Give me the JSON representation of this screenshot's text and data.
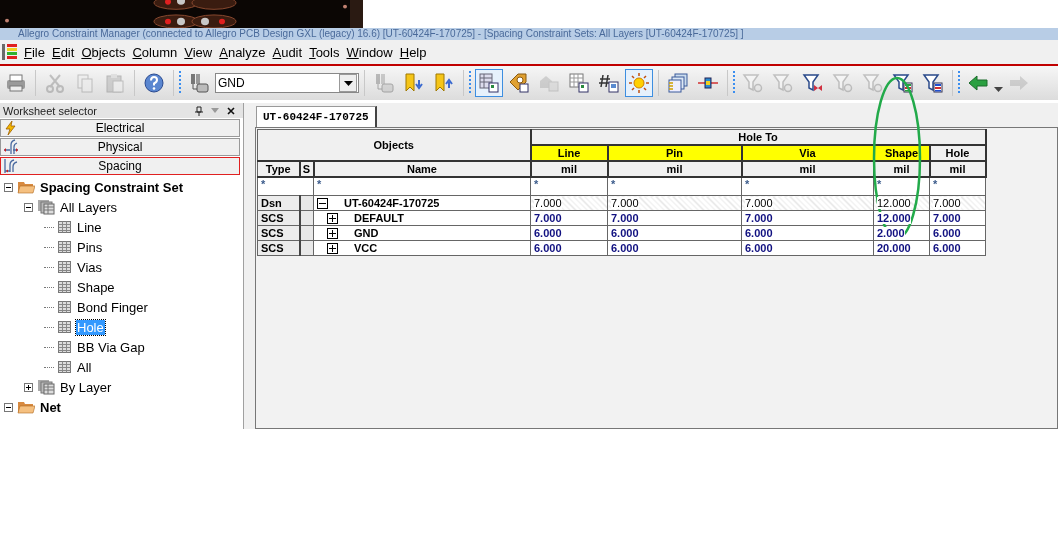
{
  "window": {
    "title": "Allegro Constraint Manager (connected to Allegro PCB Design GXL (legacy) 16.6) [UT-60424F-170725] - [Spacing Constraint Sets: All Layers [UT-60424F-170725] ]"
  },
  "menu": [
    "File",
    "Edit",
    "Objects",
    "Column",
    "View",
    "Analyze",
    "Audit",
    "Tools",
    "Window",
    "Help"
  ],
  "toolbar": [
    {
      "kind": "print",
      "disabled": false,
      "selected": false
    },
    {
      "kind": "separator"
    },
    {
      "kind": "cut",
      "disabled": true,
      "selected": false
    },
    {
      "kind": "copy",
      "disabled": true,
      "selected": false
    },
    {
      "kind": "paste",
      "disabled": true,
      "selected": false
    },
    {
      "kind": "separator"
    },
    {
      "kind": "help",
      "disabled": false,
      "selected": false
    },
    {
      "kind": "grip"
    },
    {
      "kind": "net",
      "disabled": false,
      "selected": false
    },
    {
      "kind": "combo",
      "value": "GND"
    },
    {
      "kind": "separator"
    },
    {
      "kind": "net",
      "disabled": true,
      "selected": false
    },
    {
      "kind": "bookmark-down",
      "disabled": false,
      "selected": false
    },
    {
      "kind": "bookmark-up",
      "disabled": false,
      "selected": false
    },
    {
      "kind": "grip"
    },
    {
      "kind": "worksheet",
      "disabled": false,
      "selected": true
    },
    {
      "kind": "tag",
      "disabled": false,
      "selected": false
    },
    {
      "kind": "cloud",
      "disabled": true,
      "selected": false
    },
    {
      "kind": "grid",
      "disabled": false,
      "selected": false
    },
    {
      "kind": "hash",
      "disabled": false,
      "selected": false
    },
    {
      "kind": "sun",
      "disabled": false,
      "selected": true
    },
    {
      "kind": "separator"
    },
    {
      "kind": "stack",
      "disabled": false,
      "selected": false
    },
    {
      "kind": "connector",
      "disabled": false,
      "selected": false
    },
    {
      "kind": "grip"
    },
    {
      "kind": "funnel",
      "disabled": true,
      "selected": false
    },
    {
      "kind": "funnel",
      "disabled": true,
      "selected": false
    },
    {
      "kind": "funnel-cross",
      "disabled": false,
      "selected": false
    },
    {
      "kind": "funnel",
      "disabled": true,
      "selected": false
    },
    {
      "kind": "funnel",
      "disabled": true,
      "selected": false
    },
    {
      "kind": "funnel-green",
      "disabled": false,
      "selected": false
    },
    {
      "kind": "funnel-blue",
      "disabled": false,
      "selected": false
    },
    {
      "kind": "grip"
    },
    {
      "kind": "arrow-left",
      "disabled": false,
      "selected": false
    },
    {
      "kind": "dropdown"
    },
    {
      "kind": "arrow-right",
      "disabled": true,
      "selected": false
    }
  ],
  "worksheet_selector": {
    "title": "Worksheet selector",
    "categories": [
      {
        "label": "Electrical",
        "kind": "electrical",
        "selected": false
      },
      {
        "label": "Physical",
        "kind": "physical",
        "selected": false
      },
      {
        "label": "Spacing",
        "kind": "spacing",
        "selected": true
      }
    ],
    "tree": [
      {
        "label": "Spacing Constraint Set",
        "kind": "folder",
        "expanded": true,
        "selected": false,
        "children": [
          {
            "label": "All Layers",
            "kind": "group",
            "expanded": true,
            "selected": false,
            "children": [
              {
                "label": "Line",
                "kind": "sheet",
                "selected": false
              },
              {
                "label": "Pins",
                "kind": "sheet",
                "selected": false
              },
              {
                "label": "Vias",
                "kind": "sheet",
                "selected": false
              },
              {
                "label": "Shape",
                "kind": "sheet",
                "selected": false
              },
              {
                "label": "Bond Finger",
                "kind": "sheet",
                "selected": false
              },
              {
                "label": "Hole",
                "kind": "sheet",
                "selected": true
              },
              {
                "label": "BB Via Gap",
                "kind": "sheet",
                "selected": false
              },
              {
                "label": "All",
                "kind": "sheet",
                "selected": false
              }
            ]
          },
          {
            "label": "By Layer",
            "kind": "group",
            "expanded": false,
            "selected": false
          }
        ]
      },
      {
        "label": "Net",
        "kind": "folder",
        "expanded": true,
        "selected": false
      }
    ]
  },
  "worksheet": {
    "tabs": [
      {
        "label": "UT-60424F-170725",
        "selected": true
      }
    ],
    "objects_header": "Objects",
    "group_header": "Hole To",
    "type_header": "Type",
    "s_header": "S",
    "name_header": "Name",
    "type_filter": "*",
    "name_filter": "*",
    "columns": [
      {
        "label": "Line",
        "highlighted": true,
        "unit": "mil",
        "filter": "*"
      },
      {
        "label": "Pin",
        "highlighted": true,
        "unit": "mil",
        "filter": "*"
      },
      {
        "label": "Via",
        "highlighted": true,
        "unit": "mil",
        "filter": "*"
      },
      {
        "label": "Shape",
        "highlighted": true,
        "unit": "mil",
        "filter": "*"
      },
      {
        "label": "Hole",
        "highlighted": false,
        "unit": "mil",
        "filter": "*"
      }
    ],
    "rows": [
      {
        "type": "Dsn",
        "name": "UT-60424F-170725",
        "kind": "design",
        "expanded": true,
        "values": [
          "7.000",
          "7.000",
          "7.000",
          "12.000",
          "7.000"
        ],
        "children": [
          {
            "type": "SCS",
            "name": "DEFAULT",
            "kind": "set",
            "expanded": false,
            "values": [
              "7.000",
              "7.000",
              "7.000",
              "12.000",
              "7.000"
            ]
          },
          {
            "type": "SCS",
            "name": "GND",
            "kind": "set",
            "expanded": false,
            "values": [
              "6.000",
              "6.000",
              "6.000",
              "2.000",
              "6.000"
            ]
          },
          {
            "type": "SCS",
            "name": "VCC",
            "kind": "set",
            "expanded": false,
            "values": [
              "6.000",
              "6.000",
              "6.000",
              "20.000",
              "6.000"
            ]
          }
        ]
      }
    ]
  }
}
